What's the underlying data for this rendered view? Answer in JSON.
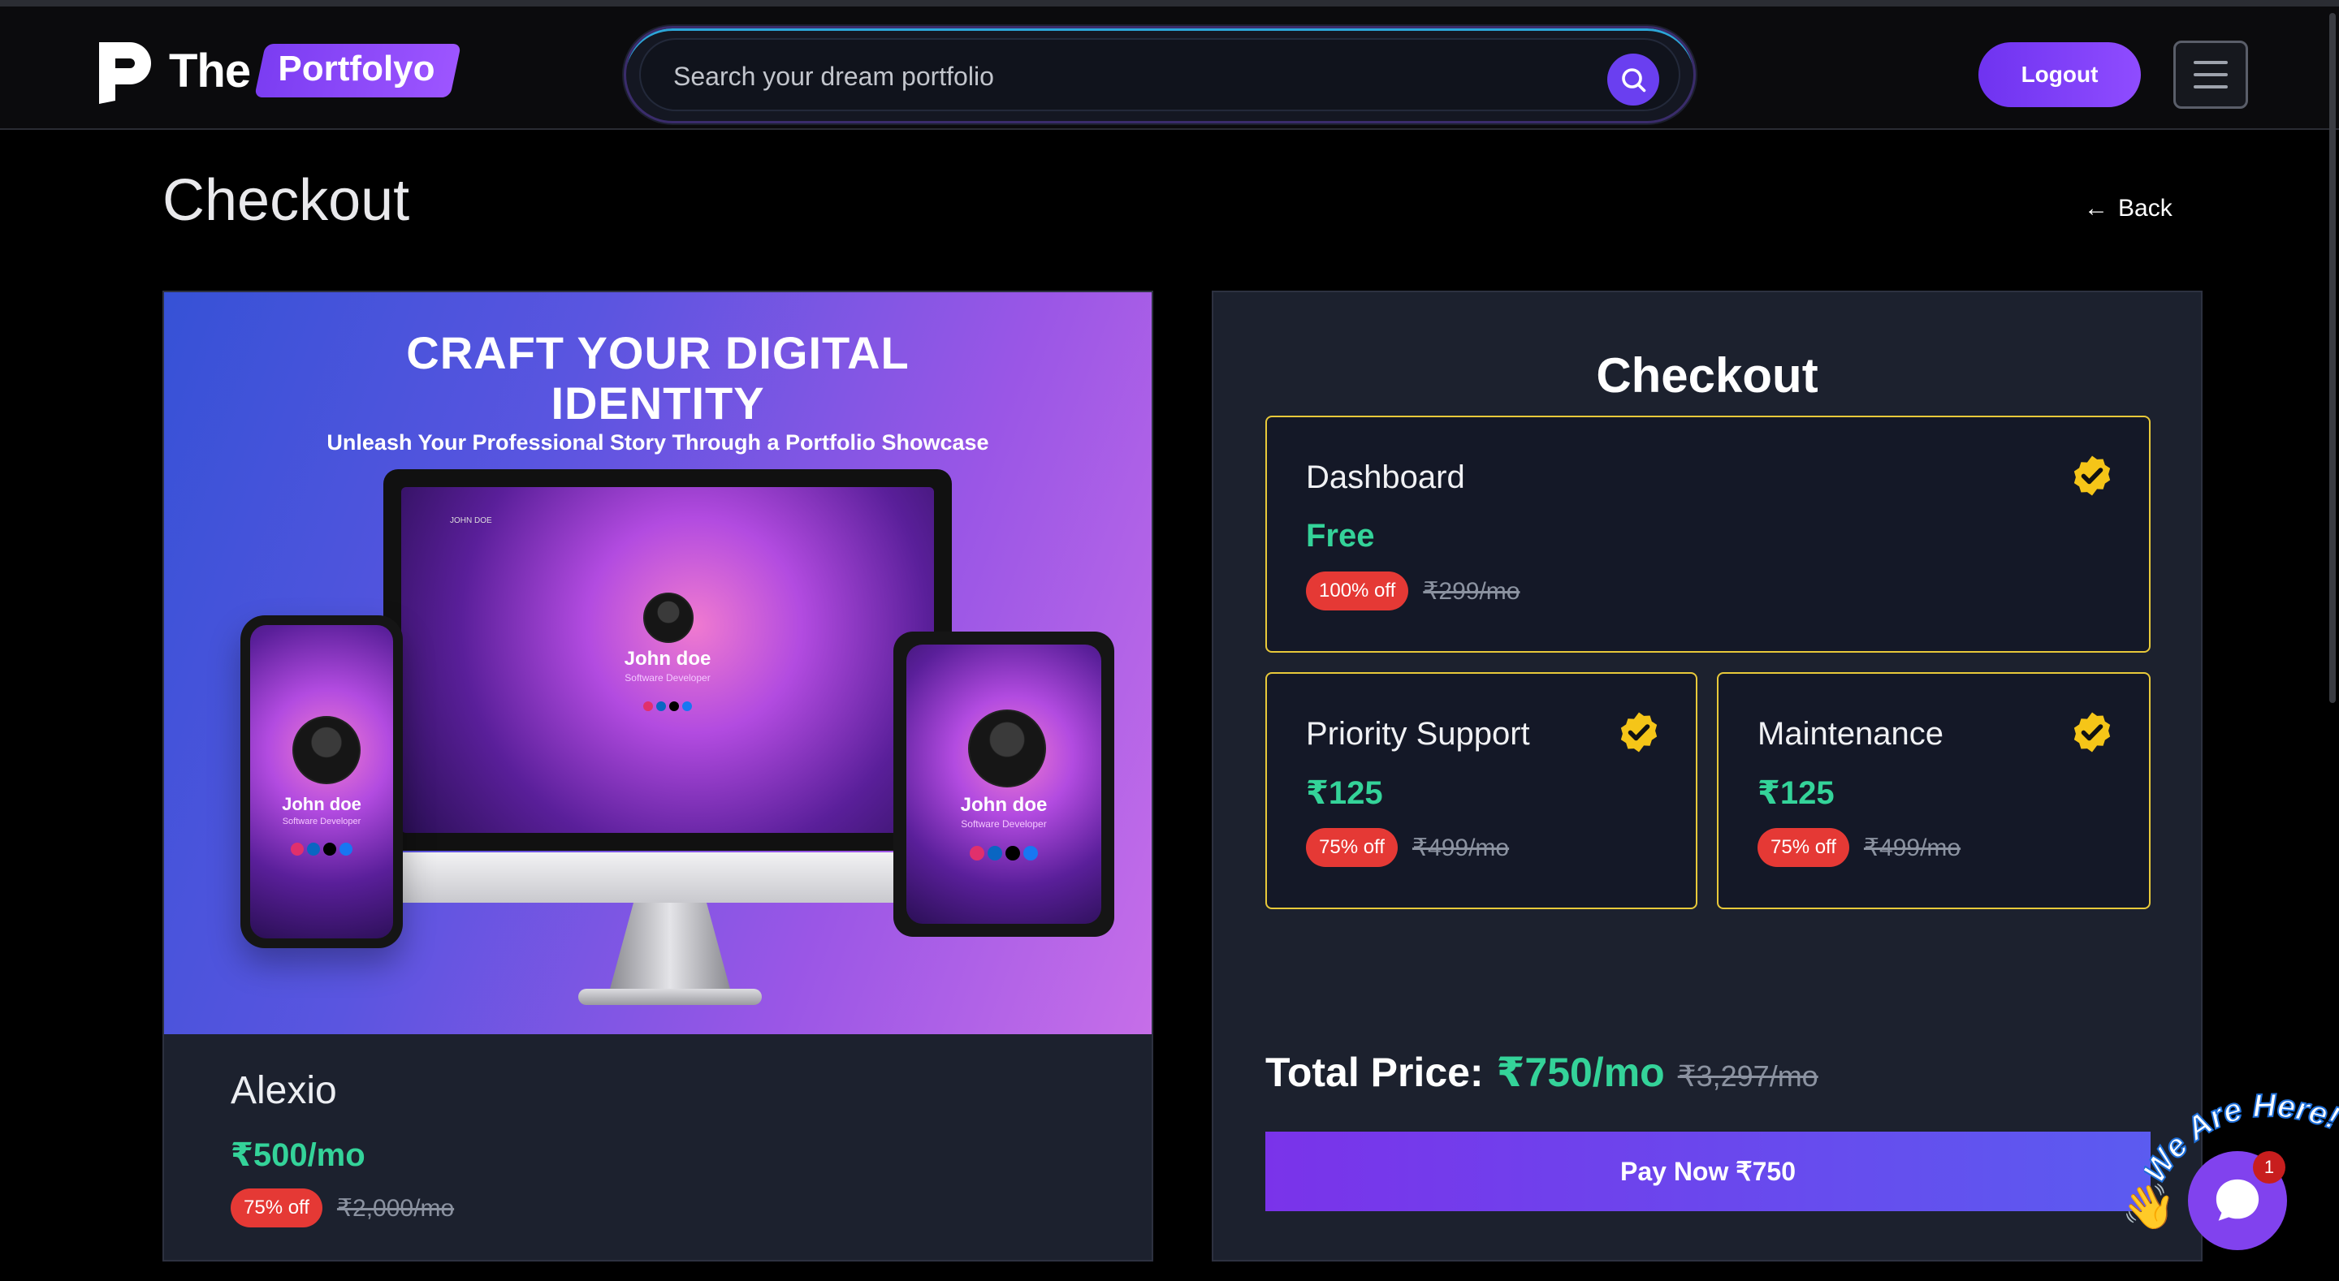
{
  "header": {
    "logo_the": "The",
    "logo_portfolyo": "Portfolyo",
    "search_placeholder": "Search your dream portfolio",
    "logout_label": "Logout"
  },
  "page": {
    "title": "Checkout",
    "back_label": "Back"
  },
  "product": {
    "hero_title_line1": "CRAFT YOUR DIGITAL",
    "hero_title_line2": "IDENTITY",
    "hero_subtitle": "Unleash Your Professional Story Through a Portfolio Showcase",
    "mock_name": "John doe",
    "mock_role": "Software Developer",
    "mock_header": "JOHN DOE",
    "name": "Alexio",
    "price": "₹500/mo",
    "discount": "75% off",
    "original_price": "₹2,000/mo"
  },
  "checkout": {
    "title": "Checkout",
    "options": [
      {
        "name": "Dashboard",
        "price": "Free",
        "discount": "100% off",
        "original_price": "₹299/mo"
      },
      {
        "name": "Priority Support",
        "price": "₹125",
        "discount": "75% off",
        "original_price": "₹499/mo"
      },
      {
        "name": "Maintenance",
        "price": "₹125",
        "discount": "75% off",
        "original_price": "₹499/mo"
      }
    ],
    "total_label": "Total Price:",
    "total_price": "₹750/mo",
    "total_original": "₹3,297/mo",
    "pay_label": "Pay Now ₹750"
  },
  "chat": {
    "banner": "We Are Here!",
    "unread_count": "1"
  },
  "colors": {
    "accent_purple": "#7b3df2",
    "price_green": "#34d399",
    "badge_red": "#e53935",
    "option_border": "#e8c93a",
    "card_bg": "#1c212e"
  }
}
